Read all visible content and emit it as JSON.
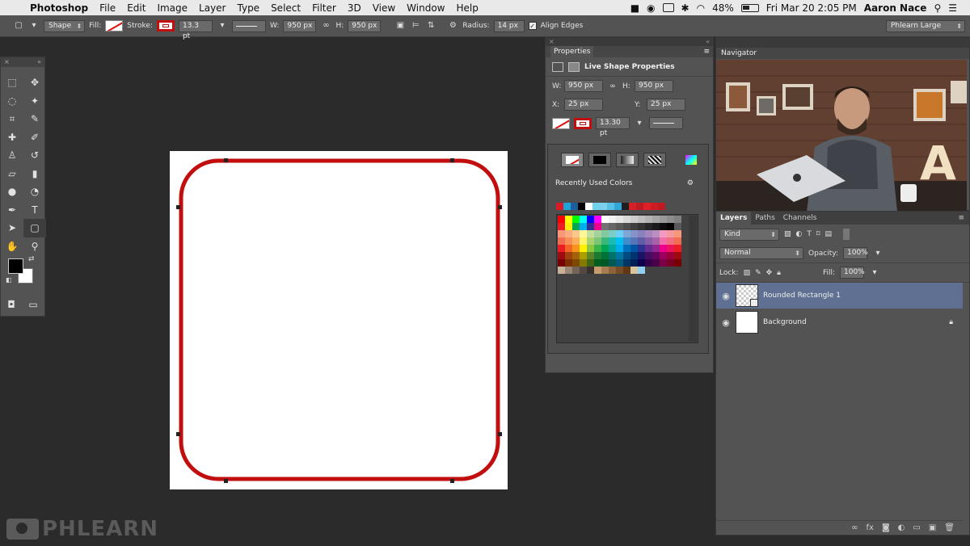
{
  "menubar": {
    "apple": "",
    "app": "Photoshop",
    "items": [
      "File",
      "Edit",
      "Image",
      "Layer",
      "Type",
      "Select",
      "Filter",
      "3D",
      "View",
      "Window",
      "Help"
    ],
    "battery": "48%",
    "datetime": "Fri Mar 20  2:05 PM",
    "user": "Aaron Nace"
  },
  "options": {
    "tool_mode": "Shape",
    "fill_label": "Fill:",
    "stroke_label": "Stroke:",
    "stroke_width": "13.3 pt",
    "w_label": "W:",
    "w_value": "950 px",
    "h_label": "H:",
    "h_value": "950 px",
    "radius_label": "Radius:",
    "radius_value": "14 px",
    "align_edges": "Align Edges",
    "workspace": "Phlearn Large"
  },
  "properties": {
    "tab": "Properties",
    "title": "Live Shape Properties",
    "w_label": "W:",
    "w": "950 px",
    "h_label": "H:",
    "h": "950 px",
    "x_label": "X:",
    "x": "25 px",
    "y_label": "Y:",
    "y": "25 px",
    "stroke_width": "13.30 pt"
  },
  "color_popup": {
    "recent_label": "Recently Used Colors",
    "recent": [
      "#d81b26",
      "#1fa3d8",
      "#1b5e9e",
      "#000000",
      "#ffffff",
      "#6fd3f0",
      "#7bd0ec",
      "#58c0e4",
      "#30a7d8",
      "#1e1e1e",
      "#d62027",
      "#c01a22",
      "#e01f26",
      "#cc1d24",
      "#bd1b21"
    ],
    "swatches": [
      "#ff0000",
      "#ffff00",
      "#00ff00",
      "#00ffff",
      "#0000ff",
      "#ff00ff",
      "#ffffff",
      "#f2f2f2",
      "#e6e6e6",
      "#d9d9d9",
      "#cccccc",
      "#bfbfbf",
      "#b3b3b3",
      "#a6a6a6",
      "#999999",
      "#8c8c8c",
      "#808080",
      "#ed1c24",
      "#fff200",
      "#00a651",
      "#00aeef",
      "#2e3192",
      "#ec008c",
      "#737373",
      "#666666",
      "#595959",
      "#4d4d4d",
      "#404040",
      "#333333",
      "#262626",
      "#1a1a1a",
      "#0d0d0d",
      "#000000",
      "#595959",
      "#f7977a",
      "#f9ad81",
      "#fdc68a",
      "#fff79a",
      "#c4df9b",
      "#a2d39c",
      "#82ca9d",
      "#7bcdc8",
      "#6ecff6",
      "#7ea7d8",
      "#8493ca",
      "#8882be",
      "#a187be",
      "#bc8dbf",
      "#f49ac2",
      "#f6989d",
      "#f7977a",
      "#f26c4f",
      "#f68e55",
      "#fbaf5c",
      "#fff467",
      "#acd372",
      "#7cc576",
      "#3bb878",
      "#1abbb4",
      "#00bff3",
      "#438cca",
      "#5574b9",
      "#605ca8",
      "#855fa8",
      "#a763a8",
      "#f06ea9",
      "#f26d7d",
      "#f26c4f",
      "#ed1c24",
      "#f26522",
      "#f7941d",
      "#fff200",
      "#8dc73f",
      "#39b54a",
      "#00a651",
      "#00a99d",
      "#00aeef",
      "#0072bc",
      "#0054a6",
      "#2e3192",
      "#662d91",
      "#92278f",
      "#ec008c",
      "#ed145b",
      "#ed1c24",
      "#9e0b0f",
      "#a0410d",
      "#a36209",
      "#aba000",
      "#598527",
      "#1a7b30",
      "#007236",
      "#00746b",
      "#0076a3",
      "#004b80",
      "#003471",
      "#1b1464",
      "#440e62",
      "#630460",
      "#9e005d",
      "#9e0039",
      "#9e0b0f",
      "#790000",
      "#7b2e00",
      "#7d4900",
      "#827b00",
      "#406618",
      "#005e20",
      "#005826",
      "#005952",
      "#005b7f",
      "#003663",
      "#002157",
      "#0d004c",
      "#32004b",
      "#4b0049",
      "#7b0046",
      "#7a0026",
      "#790000",
      "#c7b299",
      "#998675",
      "#736357",
      "#534741",
      "#37302d",
      "#c69c6d",
      "#a67c52",
      "#8c6239",
      "#754c24",
      "#603913",
      "#d9c4a0",
      "#8fd0f0"
    ]
  },
  "navigator": {
    "tab": "Navigator"
  },
  "layers": {
    "tabs": [
      "Layers",
      "Paths",
      "Channels"
    ],
    "kind": "Kind",
    "blend": "Normal",
    "opacity_label": "Opacity:",
    "opacity": "100%",
    "lock_label": "Lock:",
    "fill_label": "Fill:",
    "fill": "100%",
    "items": [
      {
        "name": "Rounded Rectangle 1",
        "selected": true
      },
      {
        "name": "Background",
        "selected": false
      }
    ]
  },
  "watermark": "PHLEARN",
  "colors": {
    "stroke": "#c10e0e",
    "selection": "#5f7092",
    "panel": "#535353"
  }
}
